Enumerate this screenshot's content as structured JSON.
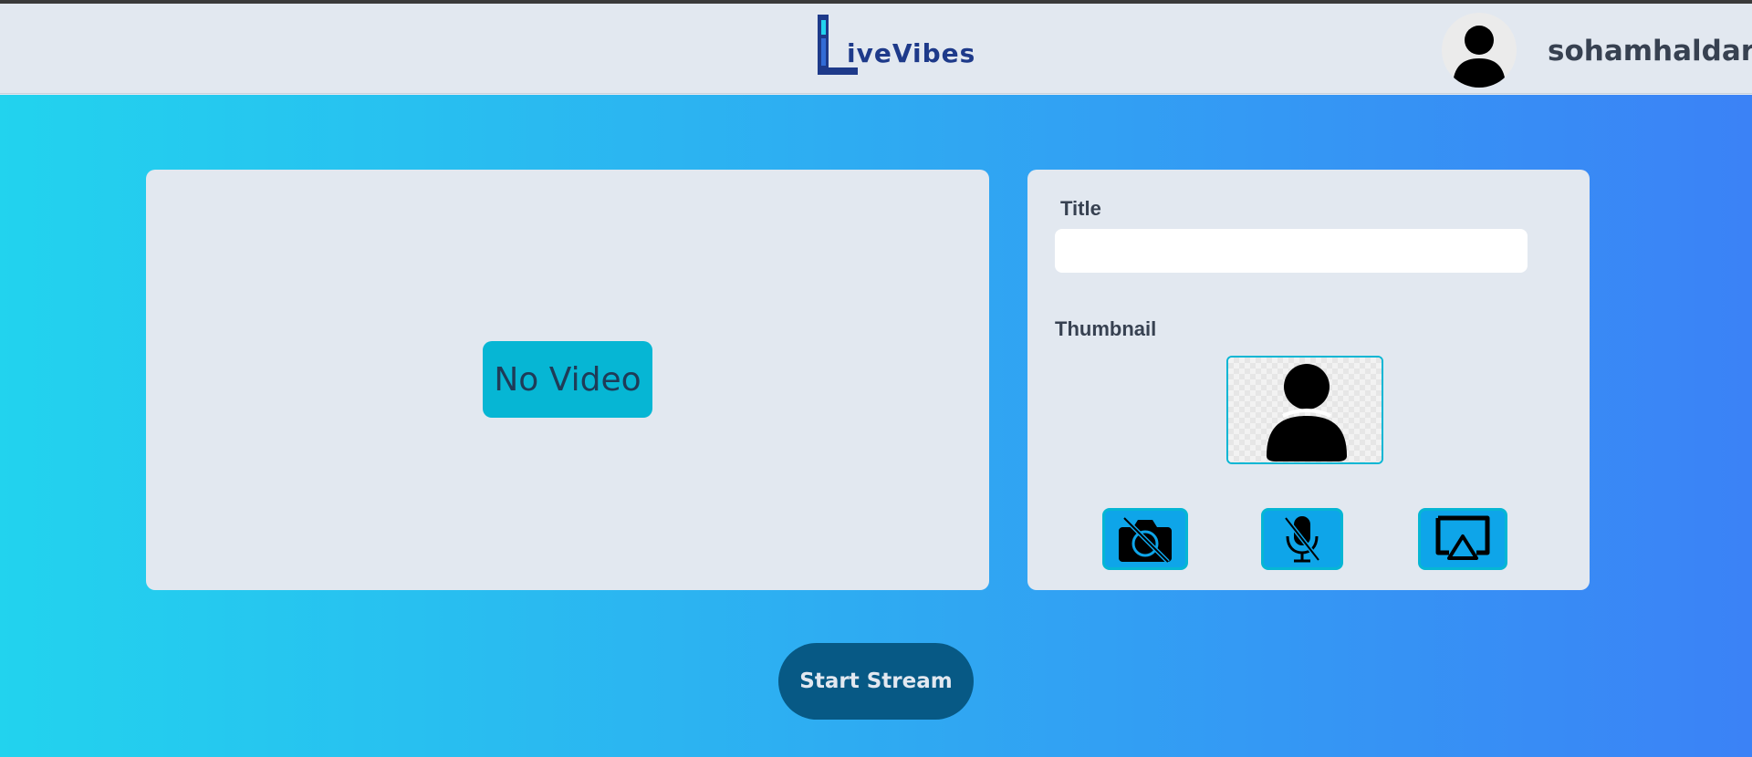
{
  "navbar": {
    "logo_text": "iveVibes",
    "username": "sohamhaldar"
  },
  "video": {
    "placeholder": "No Video"
  },
  "form": {
    "title_label": "Title",
    "title_value": "",
    "thumbnail_label": "Thumbnail"
  },
  "controls": {
    "camera_icon": "camera-off-icon",
    "mic_icon": "mic-off-icon",
    "screen_icon": "screen-share-icon",
    "button_color": "#0ea5e9",
    "border_color": "#06b6d4"
  },
  "actions": {
    "start_label": "Start Stream"
  },
  "colors": {
    "gradient_start": "#22d3ee",
    "gradient_end": "#3b82f6",
    "panel_bg": "#e2e8f0",
    "start_button_bg": "#075985",
    "no_video_bg": "#06b6d4"
  }
}
